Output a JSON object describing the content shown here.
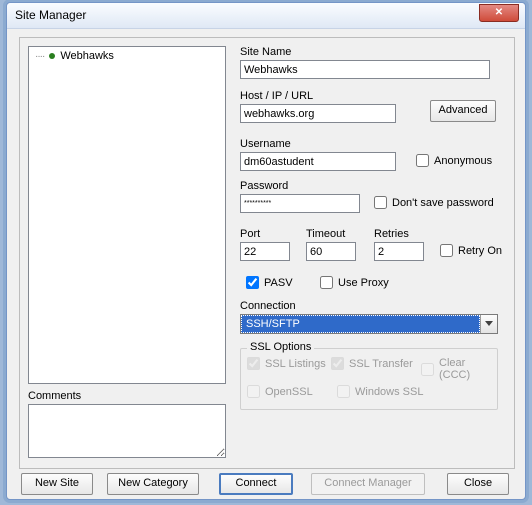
{
  "window": {
    "title": "Site Manager"
  },
  "tree": {
    "items": [
      {
        "label": "Webhawks"
      }
    ]
  },
  "comments": {
    "label": "Comments",
    "value": ""
  },
  "form": {
    "siteName": {
      "label": "Site Name",
      "value": "Webhawks"
    },
    "host": {
      "label": "Host / IP / URL",
      "value": "webhawks.org"
    },
    "advanced": "Advanced",
    "username": {
      "label": "Username",
      "value": "dm60astudent"
    },
    "anonymous": {
      "label": "Anonymous",
      "checked": false
    },
    "password": {
      "label": "Password",
      "value": "**********"
    },
    "dontSave": {
      "label": "Don't save password",
      "checked": false
    },
    "port": {
      "label": "Port",
      "value": "22"
    },
    "timeout": {
      "label": "Timeout",
      "value": "60"
    },
    "retries": {
      "label": "Retries",
      "value": "2"
    },
    "retryOn": {
      "label": "Retry On",
      "checked": false
    },
    "pasv": {
      "label": "PASV",
      "checked": true
    },
    "useProxy": {
      "label": "Use Proxy",
      "checked": false
    },
    "connection": {
      "label": "Connection",
      "value": "SSH/SFTP"
    },
    "sslOptions": {
      "legend": "SSL Options",
      "sslListings": {
        "label": "SSL Listings",
        "checked": true
      },
      "sslTransfer": {
        "label": "SSL Transfer",
        "checked": true
      },
      "clearCcc": {
        "label": "Clear (CCC)",
        "checked": false
      },
      "openSsl": {
        "label": "OpenSSL",
        "checked": false
      },
      "windowsSsl": {
        "label": "Windows SSL",
        "checked": false
      }
    }
  },
  "buttons": {
    "newSite": "New Site",
    "newCategory": "New Category",
    "connect": "Connect",
    "connectManager": "Connect Manager",
    "close": "Close"
  }
}
